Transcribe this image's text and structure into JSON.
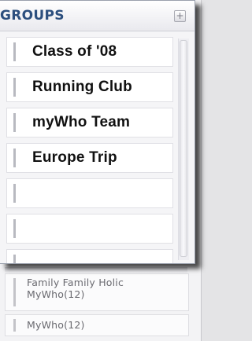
{
  "panel": {
    "title": "GROUPS",
    "add_symbol": "+",
    "groups": [
      {
        "label": "Class of '08"
      },
      {
        "label": "Running Club"
      },
      {
        "label": "myWho Team"
      },
      {
        "label": "Europe Trip"
      },
      {
        "label": ""
      },
      {
        "label": ""
      },
      {
        "label": ""
      }
    ]
  },
  "background_list": {
    "items": [
      {
        "label": "Family Family Holic MyWho(12)"
      },
      {
        "label": "MyWho(12)"
      }
    ]
  },
  "icons": {
    "add": "plus-box-icon"
  },
  "colors": {
    "title": "#2c4f7e",
    "panel_bg": "#f5f5f7",
    "row_bg": "#ffffff",
    "row_bar": "#b8b9c0"
  }
}
